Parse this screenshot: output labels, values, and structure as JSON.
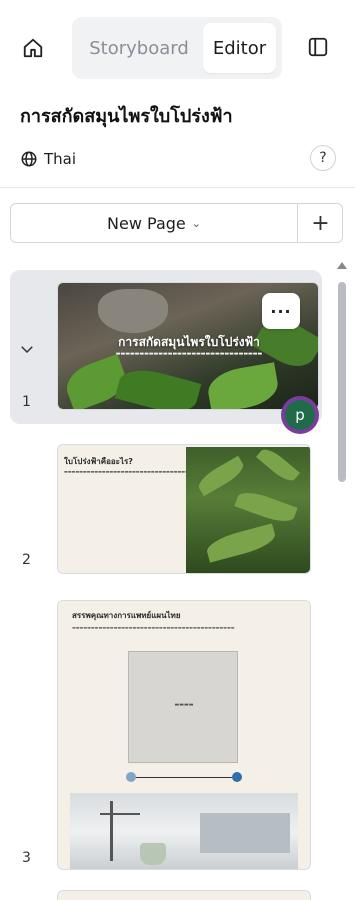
{
  "toolbar": {
    "home_icon": "home-icon",
    "tabs": [
      {
        "label": "Storyboard",
        "active": false
      },
      {
        "label": "Editor",
        "active": true
      }
    ],
    "panel_icon": "sidebar-panel-icon"
  },
  "document": {
    "title": "การสกัดสมุนไพรใบโปร่งฟ้า",
    "language": "Thai",
    "language_icon": "globe-icon",
    "help_label": "?"
  },
  "new_page": {
    "label": "New Page",
    "caret": "⌄",
    "add_label": "+"
  },
  "pages": [
    {
      "number": "1",
      "selected": true,
      "more_label": "···",
      "avatar_letter": "p",
      "slide_title": "การสกัดสมุนไพรใบโปร่งฟ้า"
    },
    {
      "number": "2",
      "selected": false,
      "slide_title": "ใบโปร่งฟ้าคืออะไร?"
    },
    {
      "number": "3",
      "selected": false,
      "slide_title": "สรรพคุณทางการแพทย์แผนไทย"
    }
  ],
  "colors": {
    "accent_avatar_ring": "#7a3d9e",
    "avatar_fill": "#1f6b4a",
    "selected_bg": "#e7e8eb"
  }
}
